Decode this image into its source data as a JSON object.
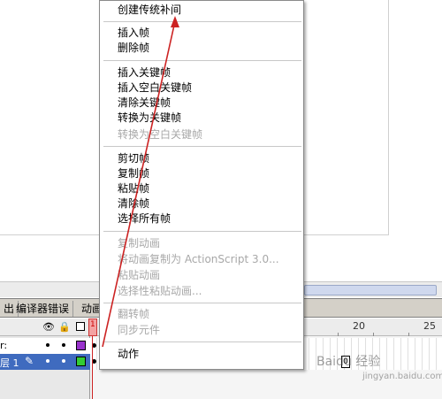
{
  "panel_tabs": [
    "出",
    "编译器错误",
    "动画"
  ],
  "timeline": {
    "playhead_frame": "1",
    "ruler_numbers": [
      "20",
      "25"
    ],
    "layers": [
      {
        "name": "r:",
        "color": "#9933cc"
      },
      {
        "name": "层 1",
        "color": "#33cc33"
      }
    ],
    "header_icons": [
      "eye-icon",
      "lock-icon",
      "outline-icon"
    ],
    "frame_marker": "0"
  },
  "context_menu": {
    "groups": [
      [
        {
          "label": "创建传统补间",
          "enabled": true
        }
      ],
      [
        {
          "label": "插入帧",
          "enabled": true
        },
        {
          "label": "删除帧",
          "enabled": true
        }
      ],
      [
        {
          "label": "插入关键帧",
          "enabled": true
        },
        {
          "label": "插入空白关键帧",
          "enabled": true
        },
        {
          "label": "清除关键帧",
          "enabled": true
        },
        {
          "label": "转换为关键帧",
          "enabled": true
        },
        {
          "label": "转换为空白关键帧",
          "enabled": false
        }
      ],
      [
        {
          "label": "剪切帧",
          "enabled": true
        },
        {
          "label": "复制帧",
          "enabled": true
        },
        {
          "label": "粘贴帧",
          "enabled": true
        },
        {
          "label": "清除帧",
          "enabled": true
        },
        {
          "label": "选择所有帧",
          "enabled": true
        }
      ],
      [
        {
          "label": "复制动画",
          "enabled": false
        },
        {
          "label": "将动画复制为 ActionScript 3.0...",
          "enabled": false
        },
        {
          "label": "粘贴动画",
          "enabled": false
        },
        {
          "label": "选择性粘贴动画...",
          "enabled": false
        }
      ],
      [
        {
          "label": "翻转帧",
          "enabled": false
        },
        {
          "label": "同步元件",
          "enabled": false
        }
      ],
      [
        {
          "label": "动作",
          "enabled": true
        }
      ]
    ]
  },
  "watermark": {
    "text": "Baidu 经验",
    "sub": "jingyan.baidu.com"
  },
  "colors": {
    "annotation_arrow": "#cc2222",
    "selected_layer": "#3f6bbf"
  }
}
